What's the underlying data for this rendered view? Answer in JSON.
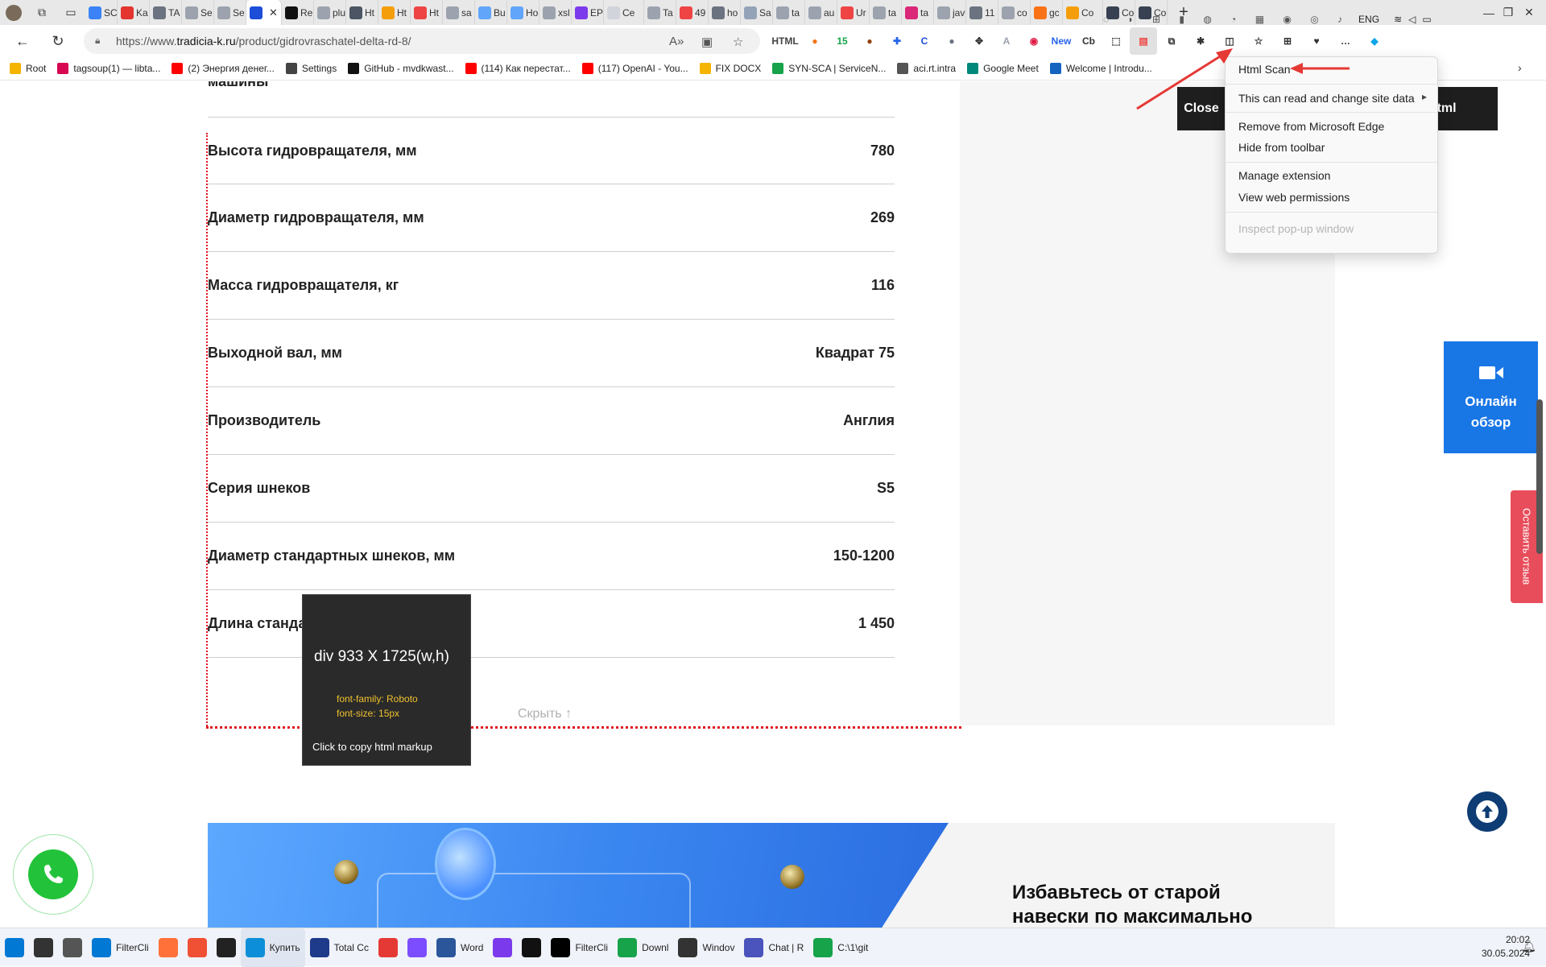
{
  "browser": {
    "tabs": [
      {
        "label": "SC",
        "icon": "blue-squiggle-icon",
        "color": "#3b82f6"
      },
      {
        "label": "Ka",
        "icon": "youtube-icon",
        "color": "#e3342f"
      },
      {
        "label": "TA",
        "icon": "cross-icon",
        "color": "#6b7280"
      },
      {
        "label": "Se",
        "icon": "gear-icon",
        "color": "#9ca3af"
      },
      {
        "label": "Se",
        "icon": "gear-icon",
        "color": "#9ca3af"
      },
      {
        "label": "",
        "icon": "shield-icon",
        "color": "#1d4ed8",
        "active": true
      },
      {
        "label": "Re",
        "icon": "r-icon",
        "color": "#111111"
      },
      {
        "label": "plu",
        "icon": "google-icon",
        "color": "#9ca3af"
      },
      {
        "label": "Ht",
        "icon": "dev-icon",
        "color": "#4b5563"
      },
      {
        "label": "Ht",
        "icon": "rainbow-icon",
        "color": "#f59e0b"
      },
      {
        "label": "Ht",
        "icon": "ext-icon",
        "color": "#ef4444"
      },
      {
        "label": "sa",
        "icon": "google-icon",
        "color": "#9ca3af"
      },
      {
        "label": "Bu",
        "icon": "snowflake-icon",
        "color": "#60a5fa"
      },
      {
        "label": "Ho",
        "icon": "snowflake-icon",
        "color": "#60a5fa"
      },
      {
        "label": "xsl",
        "icon": "google-icon",
        "color": "#9ca3af"
      },
      {
        "label": "EP",
        "icon": "d-icon",
        "color": "#7c3aed"
      },
      {
        "label": "Ce",
        "icon": "page-icon",
        "color": "#d1d5db"
      },
      {
        "label": "Ta",
        "icon": "google-icon",
        "color": "#9ca3af"
      },
      {
        "label": "49",
        "icon": "opera-icon",
        "color": "#ef4444"
      },
      {
        "label": "ho",
        "icon": "doc-icon",
        "color": "#6b7280"
      },
      {
        "label": "Sa",
        "icon": "s-icon",
        "color": "#94a3b8"
      },
      {
        "label": "ta",
        "icon": "google-icon",
        "color": "#9ca3af"
      },
      {
        "label": "au",
        "icon": "google-icon",
        "color": "#9ca3af"
      },
      {
        "label": "Ur",
        "icon": "ext-icon",
        "color": "#ef4444"
      },
      {
        "label": "ta",
        "icon": "google-icon",
        "color": "#9ca3af"
      },
      {
        "label": "ta",
        "icon": "debian-icon",
        "color": "#db2777"
      },
      {
        "label": "jav",
        "icon": "google-icon",
        "color": "#9ca3af"
      },
      {
        "label": "11",
        "icon": "doc-icon",
        "color": "#6b7280"
      },
      {
        "label": "co",
        "icon": "google-icon",
        "color": "#9ca3af"
      },
      {
        "label": "gc",
        "icon": "fire-icon",
        "color": "#f97316"
      },
      {
        "label": "Co",
        "icon": "rainbow-icon",
        "color": "#f59e0b"
      },
      {
        "label": "Co",
        "icon": "copy-icon",
        "color": "#374151"
      },
      {
        "label": "Co",
        "icon": "copy-icon",
        "color": "#374151"
      }
    ],
    "new_tab": "+",
    "address": {
      "prefix": "https://www.",
      "domain": "tradicia-k.ru",
      "path": "/product/gidrovraschatel-delta-rd-8/"
    },
    "extensions": [
      {
        "name": "html-icon",
        "label": "HTML",
        "color": "#444444"
      },
      {
        "name": "firefox-icon",
        "label": "●",
        "color": "#f97316"
      },
      {
        "name": "counter-icon",
        "label": "15",
        "color": "#16a34a"
      },
      {
        "name": "cookie-icon",
        "label": "●",
        "color": "#92400e"
      },
      {
        "name": "puzzle-blue-icon",
        "label": "✚",
        "color": "#2563eb"
      },
      {
        "name": "c-icon",
        "label": "C",
        "color": "#1d4ed8"
      },
      {
        "name": "circle-icon",
        "label": "●",
        "color": "#6b7280"
      },
      {
        "name": "move-icon",
        "label": "✥",
        "color": "#333333"
      },
      {
        "name": "a-icon",
        "label": "A",
        "color": "#9ca3af"
      },
      {
        "name": "color-wheel-icon",
        "label": "◉",
        "color": "#e11d48"
      },
      {
        "name": "new-badge-icon",
        "label": "New",
        "color": "#2563eb"
      },
      {
        "name": "cb-icon",
        "label": "Cb",
        "color": "#333333"
      },
      {
        "name": "select-icon",
        "label": "⬚",
        "color": "#333333"
      },
      {
        "name": "html-scan-icon",
        "label": "▤",
        "color": "#ef4444"
      },
      {
        "name": "copy-ext-icon",
        "label": "⧉",
        "color": "#333333"
      },
      {
        "name": "extensions-icon",
        "label": "✱",
        "color": "#333333"
      },
      {
        "name": "split-icon",
        "label": "◫",
        "color": "#333333"
      },
      {
        "name": "favorites-icon",
        "label": "☆",
        "color": "#333333"
      },
      {
        "name": "collections-icon",
        "label": "⊞",
        "color": "#333333"
      },
      {
        "name": "performance-icon",
        "label": "♥",
        "color": "#333333"
      },
      {
        "name": "more-icon",
        "label": "…",
        "color": "#333333"
      },
      {
        "name": "copilot-icon",
        "label": "◆",
        "color": "#0ea5e9"
      }
    ],
    "bookmarks": [
      {
        "label": "Root",
        "icon": "folder-icon",
        "color": "#f5b400"
      },
      {
        "label": "tagsoup(1) — libta...",
        "icon": "debian-icon",
        "color": "#d70751"
      },
      {
        "label": "(2) Энергия денег...",
        "icon": "youtube-icon",
        "color": "#ff0000"
      },
      {
        "label": "Settings",
        "icon": "gear-icon",
        "color": "#444444"
      },
      {
        "label": "GitHub - mvdkwast...",
        "icon": "github-icon",
        "color": "#111111"
      },
      {
        "label": "(114) Как перестат...",
        "icon": "youtube-icon",
        "color": "#ff0000"
      },
      {
        "label": "(117) OpenAI - You...",
        "icon": "youtube-icon",
        "color": "#ff0000"
      },
      {
        "label": "FIX DOCX",
        "icon": "folder-icon",
        "color": "#f5b400"
      },
      {
        "label": "SYN-SCA | ServiceN...",
        "icon": "syn-icon",
        "color": "#16a34a"
      },
      {
        "label": "aci.rt.intra",
        "icon": "page-icon",
        "color": "#555555"
      },
      {
        "label": "Google Meet",
        "icon": "meet-icon",
        "color": "#00897b"
      },
      {
        "label": "Welcome | Introdu...",
        "icon": "circle-icon",
        "color": "#1565c0"
      }
    ]
  },
  "page": {
    "cut_label": "машины",
    "specs": [
      {
        "name": "Высота гидровращателя, мм",
        "value": "780"
      },
      {
        "name": "Диаметр гидровращателя, мм",
        "value": "269"
      },
      {
        "name": "Масса гидровращателя, кг",
        "value": "116"
      },
      {
        "name": "Выходной вал, мм",
        "value": "Квадрат 75"
      },
      {
        "name": "Производитель",
        "value": "Англия"
      },
      {
        "name": "Серия шнеков",
        "value": "S5"
      },
      {
        "name": "Диаметр стандартных шнеков, мм",
        "value": "150-1200"
      },
      {
        "name": "Длина станда",
        "value": "1 450"
      }
    ],
    "hide_label": "Скрыть",
    "online_review": "Онлайн обзор",
    "leave_review": "Оставить отзыв",
    "banner_heading_line1": "Избавьтесь от старой",
    "banner_heading_line2": "навески по максимально"
  },
  "html_scan": {
    "dimensions": "div 933 X 1725(w,h)",
    "font_family": "font-family: Roboto",
    "font_size": "font-size: 15px",
    "copy_hint": "Click to copy html markup",
    "close_button": "Close",
    "page_html_button": "age Html"
  },
  "context_menu": {
    "title": "Html Scan",
    "site_access": "This can read and change site data",
    "remove": "Remove from Microsoft Edge",
    "hide": "Hide from toolbar",
    "manage": "Manage extension",
    "permissions": "View web permissions",
    "inspect": "Inspect pop-up window"
  },
  "taskbar": {
    "apps": [
      {
        "label": "",
        "icon": "windows-start-icon",
        "color": "#0078d4"
      },
      {
        "label": "",
        "icon": "search-icon",
        "color": "#333333"
      },
      {
        "label": "",
        "icon": "task-view-icon",
        "color": "#555555"
      },
      {
        "label": "FilterCli",
        "icon": "vscode-icon",
        "color": "#0078d4"
      },
      {
        "label": "",
        "icon": "firefox-icon",
        "color": "#ff7139"
      },
      {
        "label": "",
        "icon": "git-icon",
        "color": "#f05033"
      },
      {
        "label": "",
        "icon": "terminal-icon",
        "color": "#222222"
      },
      {
        "label": "Купить",
        "icon": "edge-icon",
        "color": "#0c8fd8",
        "active": true
      },
      {
        "label": "Total Cc",
        "icon": "total-commander-icon",
        "color": "#1e3a8a"
      },
      {
        "label": "",
        "icon": "tomato-icon",
        "color": "#e53935"
      },
      {
        "label": "",
        "icon": "paint-icon",
        "color": "#7c4dff"
      },
      {
        "label": "Word",
        "icon": "word-icon",
        "color": "#2b579a"
      },
      {
        "label": "",
        "icon": "obsidian-icon",
        "color": "#7c3aed"
      },
      {
        "label": "",
        "icon": "k-icon",
        "color": "#111111"
      },
      {
        "label": "FilterCli",
        "icon": "intellij-icon",
        "color": "#000000"
      },
      {
        "label": "Downl",
        "icon": "download-icon",
        "color": "#16a34a"
      },
      {
        "label": "Windov",
        "icon": "terminal-icon",
        "color": "#333333"
      },
      {
        "label": "Chat | R",
        "icon": "teams-icon",
        "color": "#4b53bc"
      },
      {
        "label": "C:\\1\\git",
        "icon": "notepad-icon",
        "color": "#16a34a"
      }
    ],
    "tray_language": "ENG",
    "time": "20:02",
    "date": "30.05.2024"
  },
  "colors": {
    "dotted_outline": "#e0151f",
    "arrow": "#e53935",
    "online_button": "#1976e5",
    "review_tab": "#e84d5b",
    "up_button": "#0e3c74",
    "phone": "#22c33a"
  }
}
